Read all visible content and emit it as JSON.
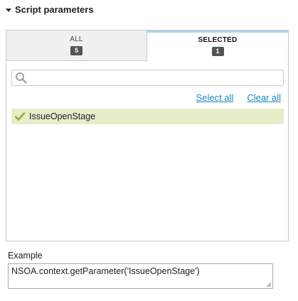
{
  "section": {
    "title": "Script parameters",
    "expand_icon": "caret-down-icon"
  },
  "tabs": [
    {
      "label": "ALL",
      "count": "5",
      "active": false
    },
    {
      "label": "SELECTED",
      "count": "1",
      "active": true
    }
  ],
  "search": {
    "value": "",
    "placeholder": "",
    "icon": "search-icon"
  },
  "actions": {
    "select_all": "Select all",
    "clear_all": "Clear all"
  },
  "items": [
    {
      "label": "IssueOpenStage",
      "selected": true,
      "icon": "check-icon"
    }
  ],
  "example": {
    "label": "Example",
    "value": "NSOA.context.getParameter('IssueOpenStage')"
  },
  "colors": {
    "accent_link": "#1a87c4",
    "selected_row": "#e7edc8",
    "check": "#8cb33a",
    "active_tab_border": "#a9d4ea",
    "badge": "#555555"
  }
}
